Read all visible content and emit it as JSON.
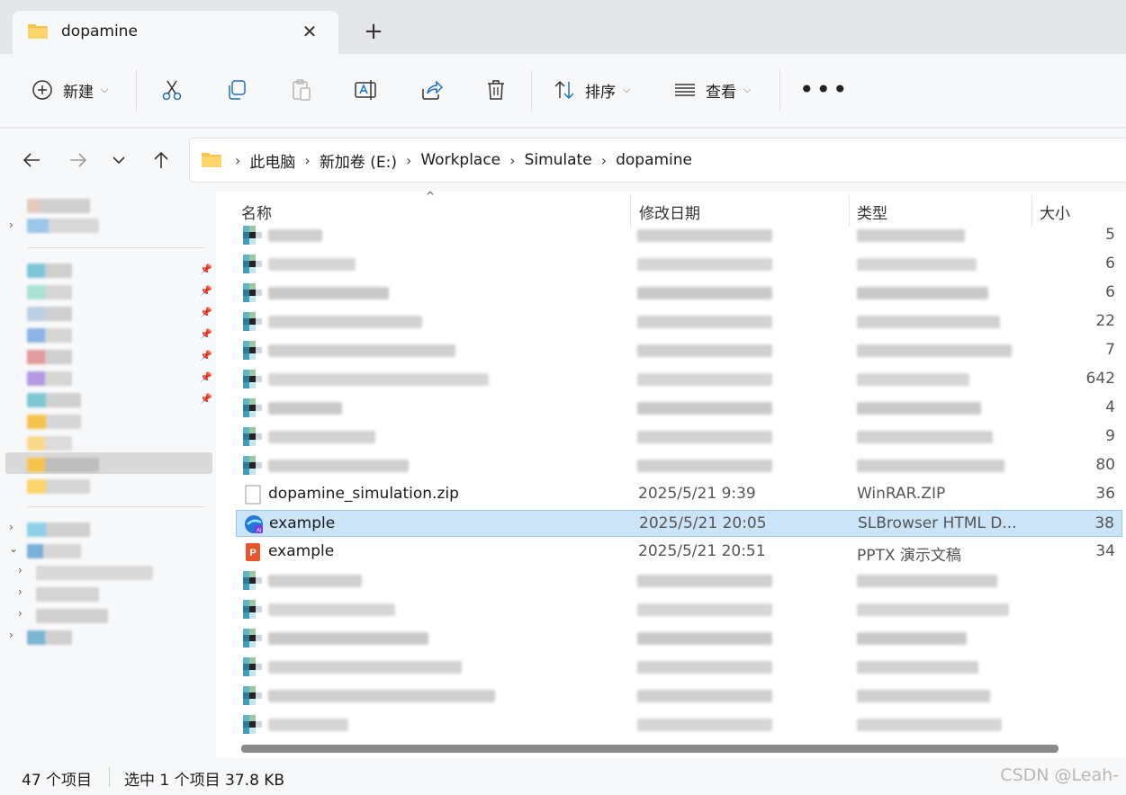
{
  "tab": {
    "title": "dopamine",
    "close": "✕",
    "new_tab": "+"
  },
  "toolbar": {
    "new_label": "新建",
    "sort_label": "排序",
    "view_label": "查看",
    "more": "•••",
    "chevron": "⌵"
  },
  "nav": {
    "back": "←",
    "forward": "→",
    "recent": "⌄",
    "up": "↑"
  },
  "breadcrumb": [
    "此电脑",
    "新加卷 (E:)",
    "Workplace",
    "Simulate",
    "dopamine"
  ],
  "breadcrumb_sep": "›",
  "columns": {
    "name": "名称",
    "modified": "修改日期",
    "type": "类型",
    "size": "大小",
    "sort_indicator": "^"
  },
  "files": [
    {
      "name": "",
      "modified": "",
      "type": "",
      "size": "5",
      "blurred": true
    },
    {
      "name": "",
      "modified": "",
      "type": "",
      "size": "6",
      "blurred": true
    },
    {
      "name": "",
      "modified": "",
      "type": "",
      "size": "6",
      "blurred": true
    },
    {
      "name": "",
      "modified": "",
      "type": "",
      "size": "22",
      "blurred": true
    },
    {
      "name": "",
      "modified": "",
      "type": "",
      "size": "7",
      "blurred": true
    },
    {
      "name": "",
      "modified": "",
      "type": "",
      "size": "642",
      "blurred": true
    },
    {
      "name": "",
      "modified": "",
      "type": "",
      "size": "4",
      "blurred": true
    },
    {
      "name": "",
      "modified": "",
      "type": "",
      "size": "9",
      "blurred": true
    },
    {
      "name": "",
      "modified": "",
      "type": "",
      "size": "80",
      "blurred": true
    },
    {
      "name": "dopamine_simulation.zip",
      "modified": "2025/5/21 9:39",
      "type": "WinRAR.ZIP",
      "size": "36",
      "blurred": false
    },
    {
      "name": "example",
      "modified": "2025/5/21 20:05",
      "type": "SLBrowser HTML D...",
      "size": "38",
      "blurred": false,
      "selected": true
    },
    {
      "name": "example",
      "modified": "2025/5/21 20:51",
      "type": "PPTX 演示文稿",
      "size": "34",
      "blurred": false
    },
    {
      "name": "",
      "modified": "",
      "type": "",
      "size": "",
      "blurred": true
    },
    {
      "name": "",
      "modified": "",
      "type": "",
      "size": "",
      "blurred": true
    },
    {
      "name": "",
      "modified": "",
      "type": "",
      "size": "",
      "blurred": true
    },
    {
      "name": "",
      "modified": "",
      "type": "",
      "size": "",
      "blurred": true
    },
    {
      "name": "",
      "modified": "",
      "type": "",
      "size": "",
      "blurred": true
    },
    {
      "name": "",
      "modified": "",
      "type": "",
      "size": "",
      "blurred": true
    }
  ],
  "status": {
    "count": "47 个项目",
    "selected": "选中 1 个项目  37.8 KB"
  },
  "watermark": "CSDN @Leah-",
  "colors": {
    "accent": "#0067c0",
    "selection": "#cce4f7",
    "folder": "#f8c44e"
  }
}
